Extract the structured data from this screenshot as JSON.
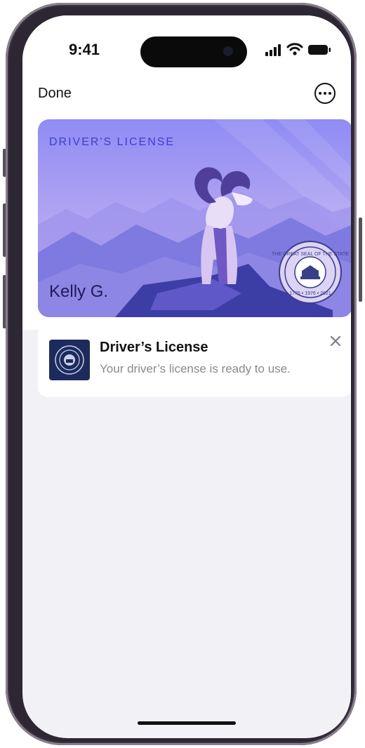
{
  "status_bar": {
    "time": "9:41",
    "icons": [
      "signal-icon",
      "wifi-icon",
      "battery-icon"
    ]
  },
  "header": {
    "done_label": "Done",
    "more_icon": "ellipsis-circle-icon"
  },
  "card": {
    "type_label": "DRIVER'S LICENSE",
    "holder_name": "Kelly G.",
    "seal_text": "THE GREAT SEAL OF THE STATE",
    "seal_years": "1776 • 1976 • 2021",
    "colors": {
      "sky_top": "#8f8cf4",
      "sky_bottom": "#d9c8f2",
      "mountain": "#7f7ae0",
      "type_label": "#3c3fcf"
    }
  },
  "notification": {
    "title": "Driver’s License",
    "body": "Your driver’s license is ready to use.",
    "icon": "state-seal-icon",
    "close_icon": "close-icon"
  }
}
